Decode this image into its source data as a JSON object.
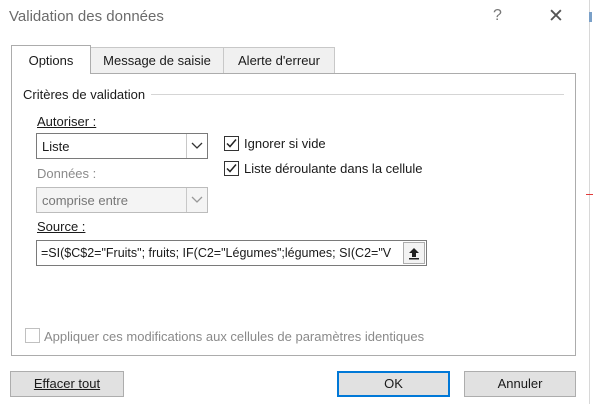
{
  "window": {
    "title": "Validation des données",
    "help_symbol": "?",
    "close_symbol": "✕"
  },
  "tabs": [
    {
      "label": "Options",
      "active": true
    },
    {
      "label": "Message de saisie",
      "active": false
    },
    {
      "label": "Alerte d'erreur",
      "active": false
    }
  ],
  "criteria": {
    "group_label": "Critères de validation",
    "autoriser_label": "Autoriser :",
    "autoriser_value": "Liste",
    "donnees_label": "Données :",
    "donnees_value": "comprise entre",
    "ignorer_label": "Ignorer si vide",
    "ignorer_checked": true,
    "liste_label": "Liste déroulante dans la cellule",
    "liste_checked": true,
    "source_label": "Source :",
    "source_value": "=SI($C$2=\"Fruits\"; fruits; IF(C2=\"Légumes\";légumes; SI(C2=\"V"
  },
  "apply_label": "Appliquer ces modifications aux cellules de paramètres identiques",
  "apply_checked": false,
  "buttons": {
    "clear": "Effacer tout",
    "ok": "OK",
    "cancel": "Annuler"
  },
  "colors": {
    "accent": "#0078d7",
    "disabled_text": "#8a8a8a"
  }
}
